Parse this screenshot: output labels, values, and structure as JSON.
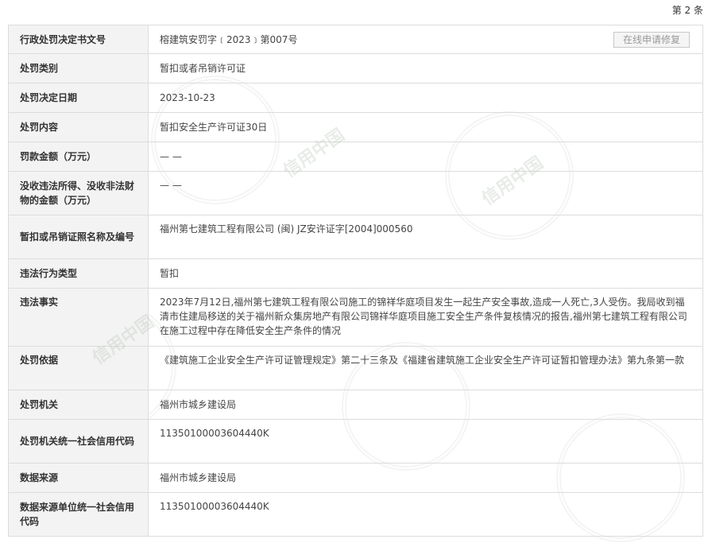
{
  "header": {
    "record_count": "第 2 条"
  },
  "actions": {
    "repair_label": "在线申请修复"
  },
  "watermark": {
    "text": "信用中国"
  },
  "rows": [
    {
      "label": "行政处罚决定书文号",
      "value": "榕建筑安罚字﹝2023﹞第007号"
    },
    {
      "label": "处罚类别",
      "value": "暂扣或者吊销许可证"
    },
    {
      "label": "处罚决定日期",
      "value": "2023-10-23"
    },
    {
      "label": "处罚内容",
      "value": "暂扣安全生产许可证30日"
    },
    {
      "label": "罚款金额（万元）",
      "value": "— —"
    },
    {
      "label": "没收违法所得、没收非法财物的金额（万元）",
      "value": "— —"
    },
    {
      "label": "暂扣或吊销证照名称及编号",
      "value": "福州第七建筑工程有限公司 (闽) JZ安许证字[2004]000560"
    },
    {
      "label": "违法行为类型",
      "value": "暂扣"
    },
    {
      "label": "违法事实",
      "value": "2023年7月12日,福州第七建筑工程有限公司施工的锦祥华庭项目发生一起生产安全事故,造成一人死亡,3人受伤。我局收到福清市住建局移送的关于福州新众集房地产有限公司锦祥华庭项目施工安全生产条件复核情况的报告,福州第七建筑工程有限公司在施工过程中存在降低安全生产条件的情况"
    },
    {
      "label": "处罚依据",
      "value": "《建筑施工企业安全生产许可证管理规定》第二十三条及《福建省建筑施工企业安全生产许可证暂扣管理办法》第九条第一款"
    },
    {
      "label": "处罚机关",
      "value": "福州市城乡建设局"
    },
    {
      "label": "处罚机关统一社会信用代码",
      "value": "11350100003604440K"
    },
    {
      "label": "数据来源",
      "value": "福州市城乡建设局"
    },
    {
      "label": "数据来源单位统一社会信用代码",
      "value": "11350100003604440K"
    }
  ]
}
